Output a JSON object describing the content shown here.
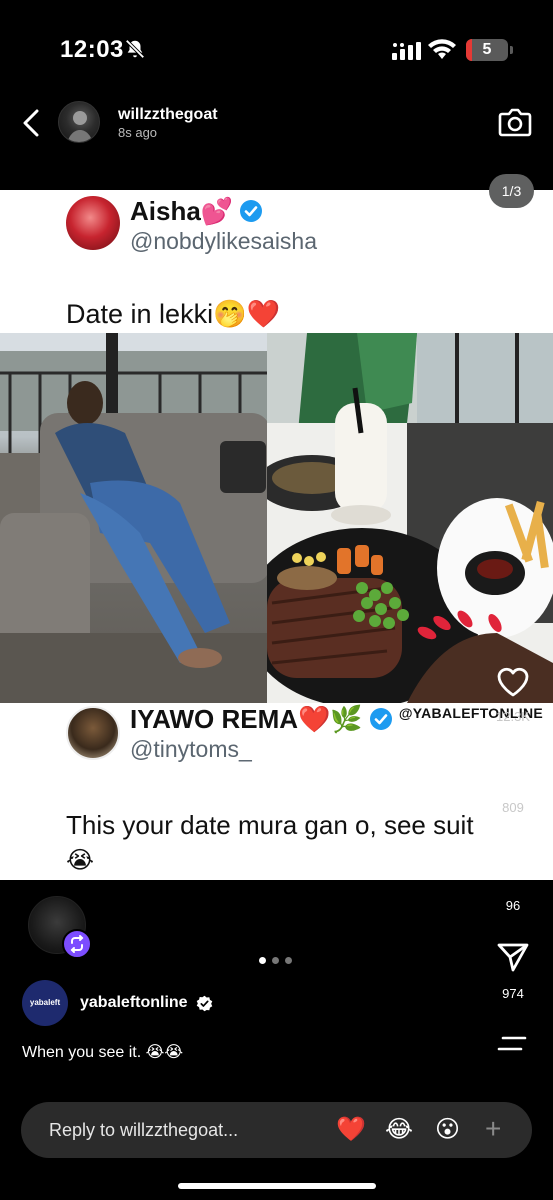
{
  "status_bar": {
    "time": "12:03",
    "battery": "5"
  },
  "header": {
    "username": "willzzthegoat",
    "time_ago": "8s ago"
  },
  "story": {
    "counter": "1/3",
    "tweet1": {
      "name": "Aisha💕",
      "handle": "@nobdylikesaisha",
      "text": "Date in lekki🤭❤️"
    },
    "tweet2": {
      "name": "IYAWO REMA❤️🌿",
      "handle": "@tinytoms_",
      "text": "This your date mura gan o, see suit",
      "text2": "😭"
    },
    "watermark": "@YABALEFTONLINE"
  },
  "actions": {
    "likes": "12.3K",
    "comments": "809",
    "reposts": "96",
    "shares": "974"
  },
  "post": {
    "account": "yabaleftonline",
    "logo_text": "yabaleft",
    "caption": "When you see it. 😭😭"
  },
  "reply": {
    "placeholder": "Reply to willzzthegoat...",
    "emojis": [
      "❤️",
      "😂",
      "😮"
    ],
    "plus": "+"
  },
  "colors": {
    "verified_blue": "#1d9bf0",
    "battery_low": "#e53935",
    "reshare_purple": "#7c4dff"
  }
}
